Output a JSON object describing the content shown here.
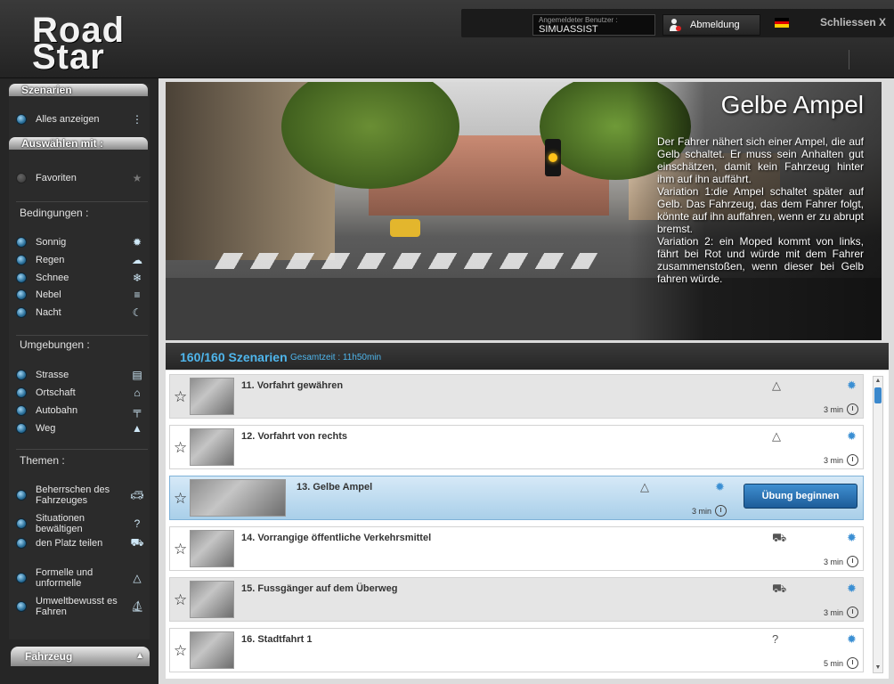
{
  "app": {
    "logo_line1": "Road",
    "logo_line2": "Star"
  },
  "header": {
    "user_label": "Angemeldeter Benutzer :",
    "user_value": "SIMUASSIST",
    "logout_label": "Abmeldung",
    "close_label": "Schliessen X",
    "flag_colors": [
      "#000000",
      "#dd0000",
      "#ffce00"
    ]
  },
  "sidebar": {
    "scenarios_title": "Szenarien",
    "show_all": "Alles anzeigen",
    "select_title": "Auswählen mit :",
    "favorites": "Favoriten",
    "conditions_title": "Bedingungen :",
    "conditions": [
      {
        "label": "Sonnig",
        "icon": "sun-icon"
      },
      {
        "label": "Regen",
        "icon": "cloud-icon"
      },
      {
        "label": "Schnee",
        "icon": "snowflake-icon"
      },
      {
        "label": "Nebel",
        "icon": "fog-icon"
      },
      {
        "label": "Nacht",
        "icon": "moon-icon"
      }
    ],
    "environments_title": "Umgebungen :",
    "environments": [
      {
        "label": "Strasse",
        "icon": "road-icon"
      },
      {
        "label": "Ortschaft",
        "icon": "town-icon"
      },
      {
        "label": "Autobahn",
        "icon": "highway-icon"
      },
      {
        "label": "Weg",
        "icon": "path-icon"
      }
    ],
    "themes_title": "Themen :",
    "themes": [
      {
        "label": "Beherrschen des Fahrzeuges",
        "icon": "car-icon"
      },
      {
        "label": "Situationen bewältigen",
        "icon": "question-icon"
      },
      {
        "label": "den Platz teilen",
        "icon": "cars-icon"
      },
      {
        "label": "Formelle und unformelle",
        "icon": "triangle-icon"
      },
      {
        "label": "Umweltbewusst es Fahren",
        "icon": "eco-icon"
      }
    ],
    "vehicle_title": "Fahrzeug"
  },
  "hero": {
    "title": "Gelbe Ampel",
    "description": "Der Fahrer nähert sich einer Ampel, die auf Gelb schaltet. Er muss  sein Anhalten gut einschätzen, damit kein Fahrzeug hinter ihm auf ihn auffährt.\nVariation 1:die Ampel schaltet später auf Gelb. Das Fahrzeug, das dem Fahrer folgt, könnte auf ihn auffahren, wenn er zu abrupt bremst.\nVariation 2: ein Moped kommt von links, fährt bei Rot und würde mit dem Fahrer zusammenstoßen, wenn dieser bei Gelb fahren würde."
  },
  "list_header": {
    "count": "160/160 Szenarien",
    "total": "Gesamtzeit : 11h50min"
  },
  "start_button": "Übung beginnen",
  "scenarios": [
    {
      "title": "11. Vorfahrt gewähren",
      "duration": "3 min",
      "category_icon": "triangle-icon",
      "weather_icon": "sun-icon",
      "style": "alt"
    },
    {
      "title": "12. Vorfahrt von rechts",
      "duration": "3 min",
      "category_icon": "triangle-icon",
      "weather_icon": "sun-icon",
      "style": ""
    },
    {
      "title": "13. Gelbe Ampel",
      "duration": "3 min",
      "category_icon": "triangle-icon",
      "weather_icon": "sun-icon",
      "style": "sel"
    },
    {
      "title": "14. Vorrangige öffentliche Verkehrsmittel",
      "duration": "3 min",
      "category_icon": "cars-icon",
      "weather_icon": "sun-icon",
      "style": ""
    },
    {
      "title": "15. Fussgänger auf dem Überweg",
      "duration": "3 min",
      "category_icon": "cars-icon",
      "weather_icon": "sun-icon",
      "style": "alt"
    },
    {
      "title": "16. Stadtfahrt 1",
      "duration": "5 min",
      "category_icon": "question-icon",
      "weather_icon": "sun-icon",
      "style": ""
    }
  ]
}
